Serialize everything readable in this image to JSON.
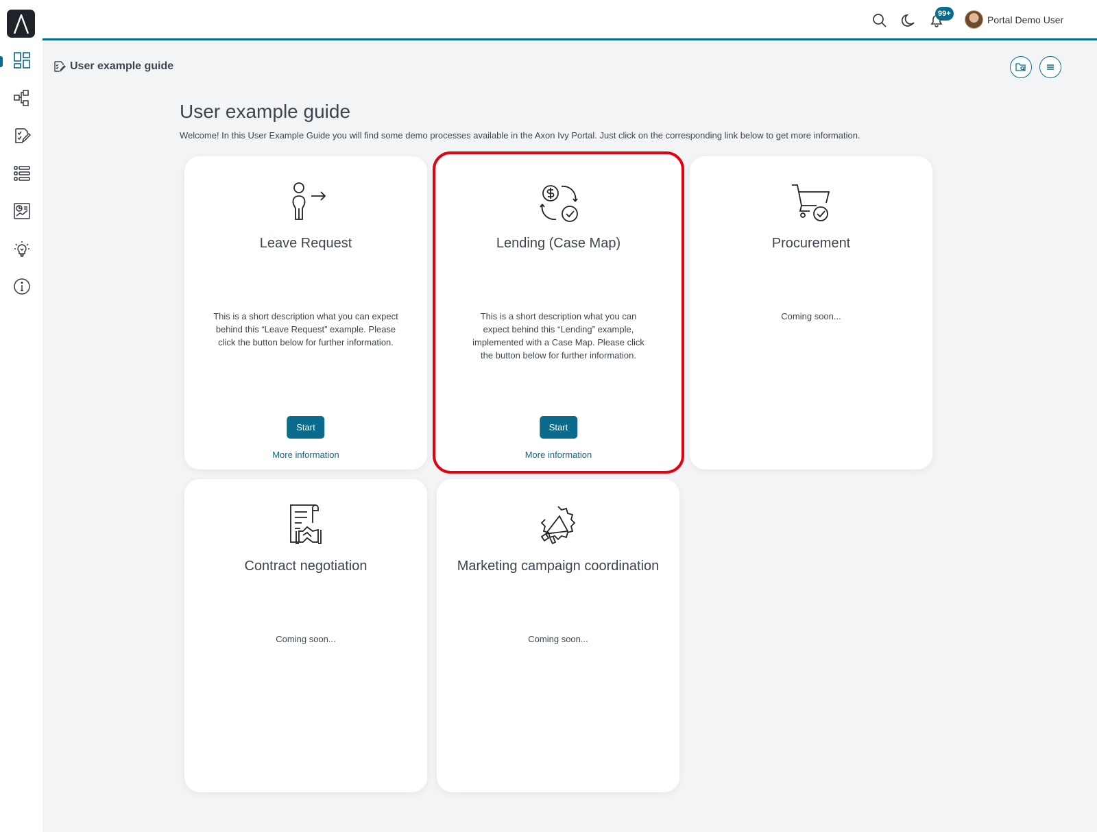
{
  "topbar": {
    "user_name": "Portal Demo User",
    "notification_count": "99+"
  },
  "page": {
    "breadcrumb_title": "User example guide",
    "heading": "User example guide",
    "lead": "Welcome! In this User Example Guide you will find some demo processes available in the Axon Ivy Portal. Just click on the corresponding link below to get more information."
  },
  "cards": [
    {
      "title": "Leave Request",
      "icon": "person-leaving-icon",
      "description": "This is a short description what you can expect behind this “Leave Request” example. Please click the button below for further information.",
      "button": "Start",
      "link": "More information"
    },
    {
      "title": "Lending (Case Map)",
      "icon": "money-cycle-check-icon",
      "description": "This is a short description what you can expect behind this “Lending” example, implemented with a Case Map. Please click the button below for further information.",
      "button": "Start",
      "link": "More information"
    },
    {
      "title": "Procurement",
      "icon": "cart-check-icon",
      "description": "Coming soon..."
    },
    {
      "title": "Contract negotiation",
      "icon": "contract-handshake-icon",
      "description": "Coming soon..."
    },
    {
      "title": "Marketing campaign coordination",
      "icon": "megaphone-badge-icon",
      "description": "Coming soon..."
    }
  ],
  "colors": {
    "accent": "#0b6b8c",
    "highlight": "#e3000f"
  }
}
